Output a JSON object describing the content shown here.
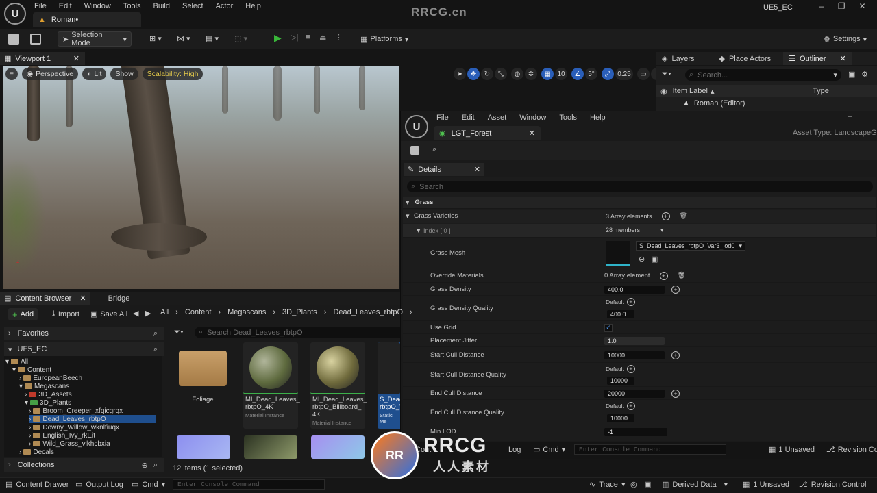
{
  "app": {
    "logo": "U",
    "menus": [
      "File",
      "Edit",
      "Window",
      "Tools",
      "Build",
      "Select",
      "Actor",
      "Help"
    ],
    "project_tab": "Roman•",
    "watermark": "RRCG.cn",
    "project_name": "UE5_EC",
    "window_controls": [
      "–",
      "❐",
      "✕"
    ]
  },
  "toolbar": {
    "selection_mode": "Selection Mode",
    "platforms": "Platforms",
    "settings": "Settings"
  },
  "viewport": {
    "tab": "Viewport 1",
    "perspective": "Perspective",
    "lit": "Lit",
    "show": "Show",
    "scalability": "Scalability: High",
    "grid_value": "10",
    "rot_value": "5°",
    "scale_value": "0.25",
    "cam_value": "1"
  },
  "right_panel": {
    "tabs": [
      "Layers",
      "Place Actors",
      "Outliner"
    ],
    "search_placeholder": "Search...",
    "col_label": "Item Label",
    "col_type": "Type",
    "row": "Roman (Editor)"
  },
  "editor": {
    "logo": "U",
    "menus": [
      "File",
      "Edit",
      "Asset",
      "Window",
      "Tools",
      "Help"
    ],
    "tab": "LGT_Forest",
    "asset_type": "Asset Type: LandscapeGras",
    "details_tab": "Details",
    "search_placeholder": "Search",
    "section": "Grass",
    "grass_varieties": {
      "label": "Grass Varieties",
      "value": "3 Array elements"
    },
    "index": {
      "label": "Index [ 0 ]",
      "value": "28 members"
    },
    "grass_mesh": {
      "label": "Grass Mesh",
      "value": "S_Dead_Leaves_rbtpO_Var3_lod0"
    },
    "override_materials": {
      "label": "Override Materials",
      "value": "0 Array element"
    },
    "grass_density": {
      "label": "Grass Density",
      "value": "400.0"
    },
    "grass_density_quality": {
      "label": "Grass Density Quality",
      "default": "Default",
      "value": "400.0"
    },
    "use_grid": {
      "label": "Use Grid",
      "checked": true
    },
    "placement_jitter": {
      "label": "Placement Jitter",
      "value": "1.0"
    },
    "start_cull": {
      "label": "Start Cull Distance",
      "value": "10000"
    },
    "start_cull_quality": {
      "label": "Start Cull Distance Quality",
      "default": "Default",
      "value": "10000"
    },
    "end_cull": {
      "label": "End Cull Distance",
      "value": "20000"
    },
    "end_cull_quality": {
      "label": "End Cull Distance Quality",
      "default": "Default",
      "value": "10000"
    },
    "min_lod": {
      "label": "Min LOD",
      "value": "-1"
    },
    "console": {
      "content_prefix": "Cont",
      "log": "Log",
      "cmd": "Cmd",
      "placeholder": "Enter Console Command",
      "unsaved": "1 Unsaved",
      "revision": "Revision Con"
    }
  },
  "content_browser": {
    "tab": "Content Browser",
    "bridge": "Bridge",
    "add": "Add",
    "import": "Import",
    "save_all": "Save All",
    "crumbs": [
      "All",
      "Content",
      "Megascans",
      "3D_Plants",
      "Dead_Leaves_rbtpO"
    ],
    "favorites": "Favorites",
    "project": "UE5_EC",
    "tree": [
      "All",
      "Content",
      "EuropeanBeech",
      "Megascans",
      "3D_Assets",
      "3D_Plants",
      "Broom_Creeper_xfqicgrqx",
      "Dead_Leaves_rbtpO",
      "Downy_Willow_wknlfiuqx",
      "English_Ivy_rkEit",
      "Wild_Grass_vlkhcbxia",
      "Decals"
    ],
    "collections": "Collections",
    "search_placeholder": "Search Dead_Leaves_rbtpO",
    "tiles": [
      {
        "label": "Foliage",
        "sub": ""
      },
      {
        "label": "MI_Dead_Leaves_ rbtpO_4K",
        "sub": "Material Instance"
      },
      {
        "label": "MI_Dead_Leaves_ rbtpO_Billboard_ 4K",
        "sub": "Material Instance"
      },
      {
        "label": "S_Dead_ rbtpO_V",
        "sub": "Static Me"
      }
    ],
    "count": "12 items (1 selected)"
  },
  "status": {
    "content_drawer": "Content Drawer",
    "output_log": "Output Log",
    "cmd": "Cmd",
    "console_placeholder": "Enter Console Command",
    "trace": "Trace",
    "derived_data": "Derived Data",
    "unsaved": "1 Unsaved",
    "revision": "Revision Control"
  },
  "overlay": {
    "logo": "RR",
    "title": "RRCG",
    "subtitle": "人人素材"
  },
  "colors": {
    "accent": "#2a5eb8",
    "play": "#39b739",
    "scalability": "#e3c94a",
    "folder": "#b08a53"
  }
}
